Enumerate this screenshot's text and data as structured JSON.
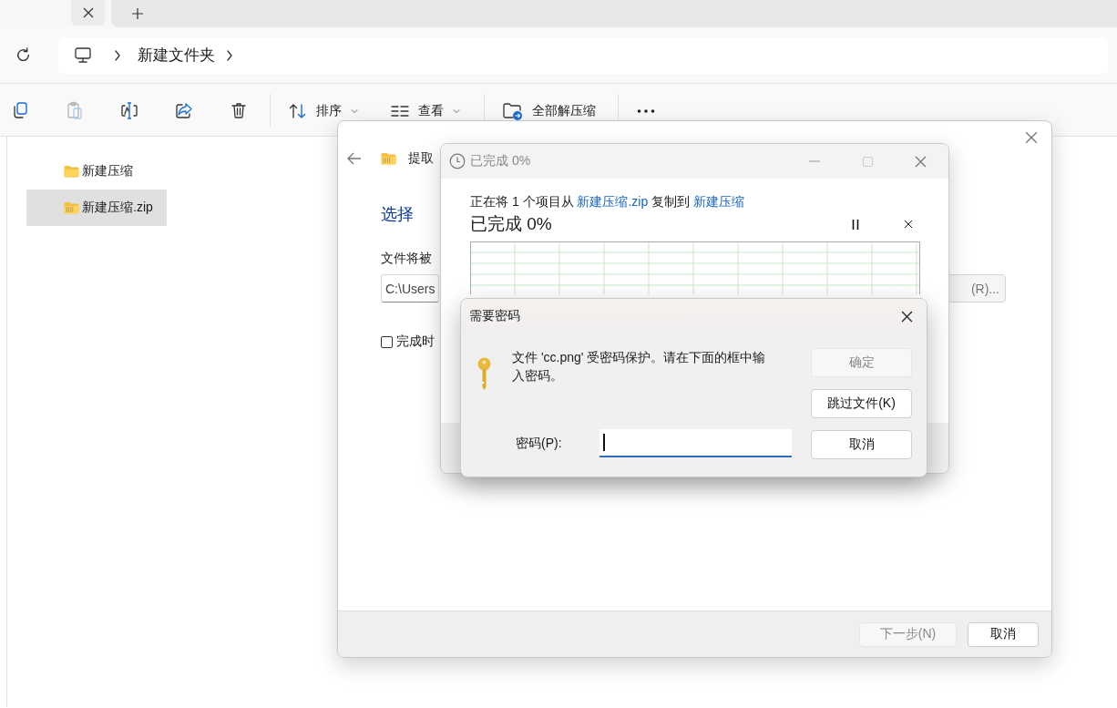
{
  "explorer": {
    "address_bar": {
      "path": [
        {
          "label": "新建文件夹"
        }
      ]
    },
    "toolbar": {
      "icon_buttons": [
        {
          "disabled": false
        },
        {
          "disabled": true
        },
        {
          "disabled": false
        },
        {
          "disabled": false
        },
        {
          "disabled": false
        }
      ],
      "menus": [
        {
          "label": "排序",
          "kind": "sort"
        },
        {
          "label": "查看",
          "kind": "view"
        }
      ],
      "extract_all": {
        "label": "全部解压缩"
      }
    },
    "files": [
      {
        "label": "新建压缩",
        "kind": "folder",
        "selected": false
      },
      {
        "label": "新建压缩.zip",
        "kind": "zip",
        "selected": true
      }
    ]
  },
  "extract_wizard": {
    "title": "提取",
    "heading": "选择",
    "destination_label": "文件将被",
    "path_value": "C:\\Users",
    "browse_button": "(R)...",
    "checkbox": {
      "label": "完成时",
      "checked": false
    },
    "buttons": [
      {
        "label": "下一步(N)",
        "disabled": true
      },
      {
        "label": "取消",
        "disabled": false
      }
    ]
  },
  "copy_progress": {
    "title": "已完成 0%",
    "message": [
      {
        "kind": "text",
        "text": "正在将 1 个项目从 "
      },
      {
        "kind": "link",
        "text": "新建压缩.zip"
      },
      {
        "kind": "text",
        "text": " 复制到 "
      },
      {
        "kind": "link",
        "text": "新建压缩"
      }
    ],
    "status": "已完成 0%"
  },
  "password_dialog": {
    "title": "需要密码",
    "message": "文件 'cc.png' 受密码保护。请在下面的框中输入密码。",
    "field_label": "密码(P):",
    "buttons": [
      {
        "label": "确定",
        "disabled": true
      },
      {
        "label": "跳过文件(K)",
        "disabled": false
      },
      {
        "label": "取消",
        "disabled": false
      }
    ]
  }
}
